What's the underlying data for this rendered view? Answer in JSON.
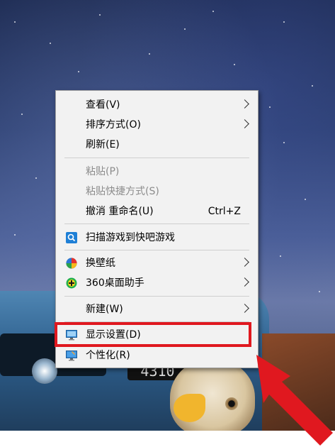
{
  "colors": {
    "menu_background": "#f2f2f2",
    "disabled_text": "#8c8c8c",
    "highlight": "#e0181f",
    "arrow": "#e0181f"
  },
  "context_menu": {
    "items": [
      {
        "label": "查看(V)",
        "submenu": true
      },
      {
        "label": "排序方式(O)",
        "submenu": true
      },
      {
        "label": "刷新(E)"
      },
      {
        "label": "粘贴(P)",
        "disabled": true
      },
      {
        "label": "粘贴快捷方式(S)",
        "disabled": true
      },
      {
        "label": "撤消 重命名(U)",
        "shortcut": "Ctrl+Z"
      },
      {
        "label": "扫描游戏到快吧游戏",
        "icon": "search-icon"
      },
      {
        "label": "换壁纸",
        "icon": "wallpaper-icon",
        "submenu": true
      },
      {
        "label": "360桌面助手",
        "icon": "plus-circle-icon",
        "submenu": true
      },
      {
        "label": "新建(W)",
        "submenu": true
      },
      {
        "label": "显示设置(D)",
        "icon": "display-icon",
        "highlighted": true
      },
      {
        "label": "个性化(R)",
        "icon": "personalize-icon"
      }
    ]
  },
  "wallpaper": {
    "plate_text": "4310"
  }
}
